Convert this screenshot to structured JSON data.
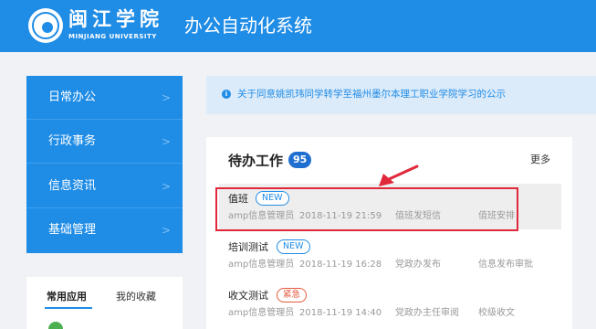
{
  "header": {
    "logo_cn": "闽江学院",
    "logo_en": "MINJIANG UNIVERSITY",
    "system_title": "办公自动化系统"
  },
  "nav": {
    "items": [
      {
        "label": "日常办公"
      },
      {
        "label": "行政事务"
      },
      {
        "label": "信息资讯"
      },
      {
        "label": "基础管理"
      }
    ],
    "chevron": ">"
  },
  "apps": {
    "tabs": [
      "常用应用",
      "我的收藏"
    ]
  },
  "notice": {
    "icon": "info-icon",
    "text": "关于同意姚凯玮同学转学至福州墨尔本理工职业学院学习的公示"
  },
  "todo": {
    "title": "待办工作",
    "count": "95",
    "more": "更多",
    "tasks": [
      {
        "name": "值班",
        "tag": "NEW",
        "sender": "amp信息管理员",
        "time": "2018-11-19 21:59",
        "step": "值班发短信",
        "process": "值班安排"
      },
      {
        "name": "培训测试",
        "tag": "NEW",
        "sender": "amp信息管理员",
        "time": "2018-11-19 16:28",
        "step": "党政办发布",
        "process": "信息发布审批"
      },
      {
        "name": "收文测试",
        "tag": "紧急",
        "sender": "amp信息管理员",
        "time": "2018-11-19 14:40",
        "step": "党政办主任审阅",
        "process": "校级收文"
      }
    ]
  },
  "colors": {
    "primary": "#1f8ce6",
    "annotation": "#e0283a",
    "urgent": "#e35a3c"
  }
}
